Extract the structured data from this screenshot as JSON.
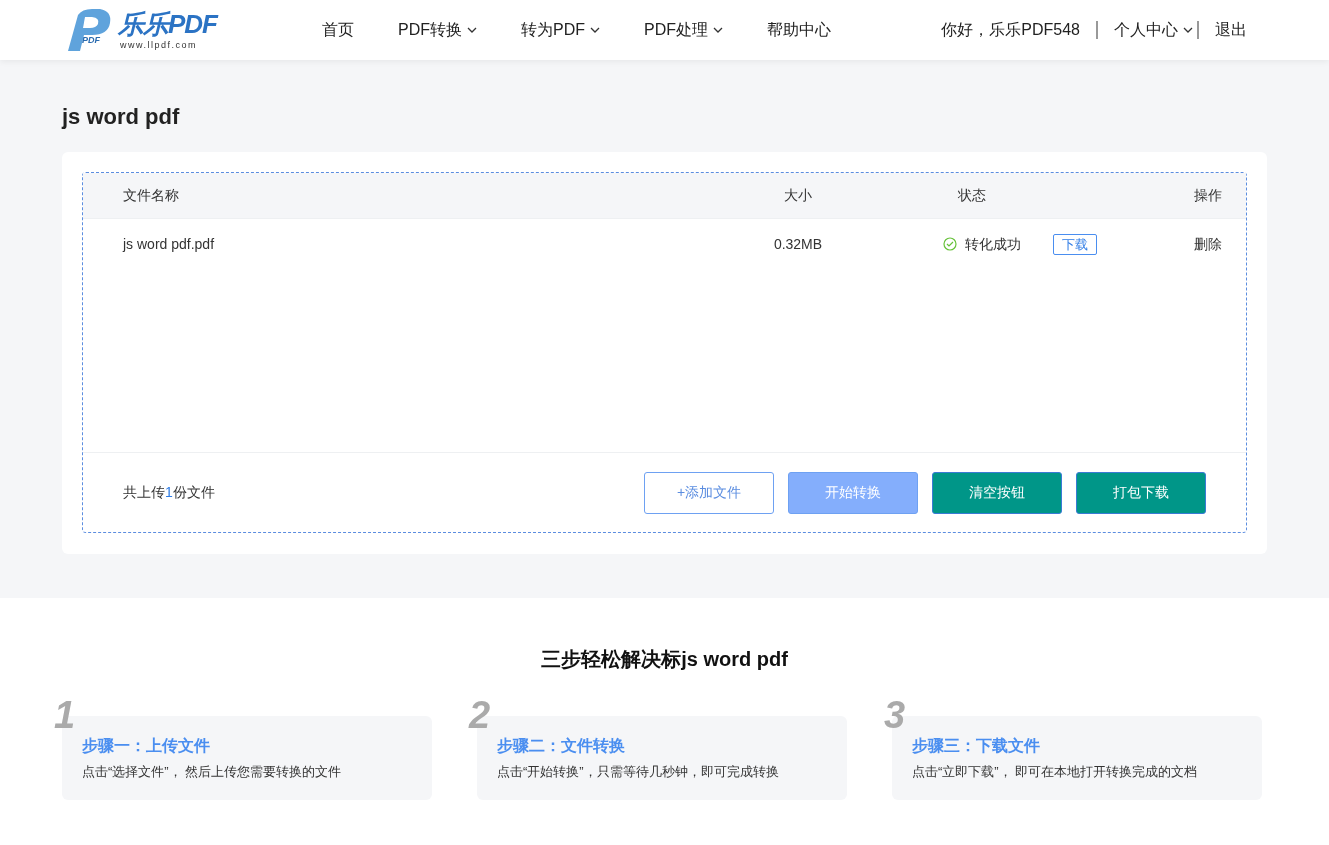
{
  "header": {
    "logo": {
      "name": "乐乐PDF",
      "url": "www.llpdf.com",
      "badge": "PDF"
    },
    "nav": [
      {
        "label": "首页",
        "dropdown": false
      },
      {
        "label": "PDF转换",
        "dropdown": true
      },
      {
        "label": "转为PDF",
        "dropdown": true
      },
      {
        "label": "PDF处理",
        "dropdown": true
      },
      {
        "label": "帮助中心",
        "dropdown": false
      }
    ],
    "greeting": "你好，乐乐PDF548",
    "user_menu": "个人中心",
    "logout": "退出"
  },
  "page_title": "js word pdf",
  "table": {
    "columns": [
      "文件名称",
      "大小",
      "状态",
      "操作"
    ],
    "rows": [
      {
        "name": "js word pdf.pdf",
        "size": "0.32MB",
        "status": "转化成功",
        "download": "下载",
        "delete": "删除"
      }
    ]
  },
  "footer": {
    "count_prefix": "共上传",
    "count": "1",
    "count_suffix": "份文件",
    "buttons": [
      {
        "label": "+添加文件",
        "kind": "outline"
      },
      {
        "label": "开始转换",
        "kind": "light"
      },
      {
        "label": "清空按钮",
        "kind": "teal"
      },
      {
        "label": "打包下载",
        "kind": "teal"
      }
    ]
  },
  "steps_title": "三步轻松解决标js word pdf",
  "steps": [
    {
      "number": "1",
      "title": "步骤一：上传文件",
      "text": "点击“选择文件”， 然后上传您需要转换的文件"
    },
    {
      "number": "2",
      "title": "步骤二：文件转换",
      "text": "点击“开始转换”，只需等待几秒钟，即可完成转换"
    },
    {
      "number": "3",
      "title": "步骤三：下载文件",
      "text": "点击“立即下载”， 即可在本地打开转换完成的文档"
    }
  ]
}
